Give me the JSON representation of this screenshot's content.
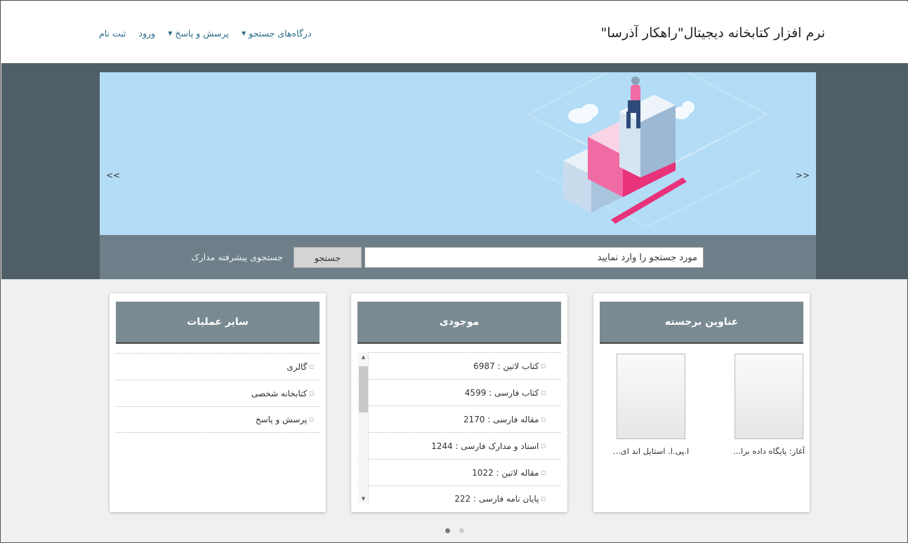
{
  "header": {
    "site_title": "نرم افزار کتابخانه دیجیتال\"راهکار آذرسا\"",
    "nav": [
      {
        "label": "درگاه‌های جستجو",
        "has_caret": true
      },
      {
        "label": "پرسش و پاسخ",
        "has_caret": true
      },
      {
        "label": "ورود",
        "has_caret": false
      },
      {
        "label": "ثبت نام",
        "has_caret": false
      }
    ]
  },
  "slider": {
    "prev_label": "<<",
    "next_label": ">>"
  },
  "search": {
    "value": "مورد جستجو را وارد نمایید",
    "button_label": "جستجو",
    "advanced_label": "جستجوی پیشرفته مدارک"
  },
  "featured": {
    "title": "عناوین برجسته",
    "items": [
      {
        "caption": "آغاز: پایگاه داده برا..."
      },
      {
        "caption": "ا.پی.ا. استایل اند ای..."
      }
    ]
  },
  "stock": {
    "title": "موجودی",
    "items": [
      {
        "label": "کتاب لاتین : 6987"
      },
      {
        "label": "کتاب فارسی : 4599"
      },
      {
        "label": "مقاله فارسی : 2170"
      },
      {
        "label": "اسناد و مدارک فارسی : 1244"
      },
      {
        "label": "مقاله لاتین : 1022"
      },
      {
        "label": "پایان نامه فارسی : 222"
      }
    ]
  },
  "other": {
    "title": "سایر عملیات",
    "items": [
      {
        "label": "گالری"
      },
      {
        "label": "کتابخانه شخصی"
      },
      {
        "label": "پرسش و پاسخ"
      }
    ]
  },
  "carousel_dots": {
    "count": 2,
    "active_index": 1
  },
  "colors": {
    "hero_band": "#4f5e67",
    "slider_bg": "#b3dcf6",
    "panel_header": "#7a8a92",
    "link": "#2a6d8a",
    "accent_pink": "#e8327a"
  }
}
